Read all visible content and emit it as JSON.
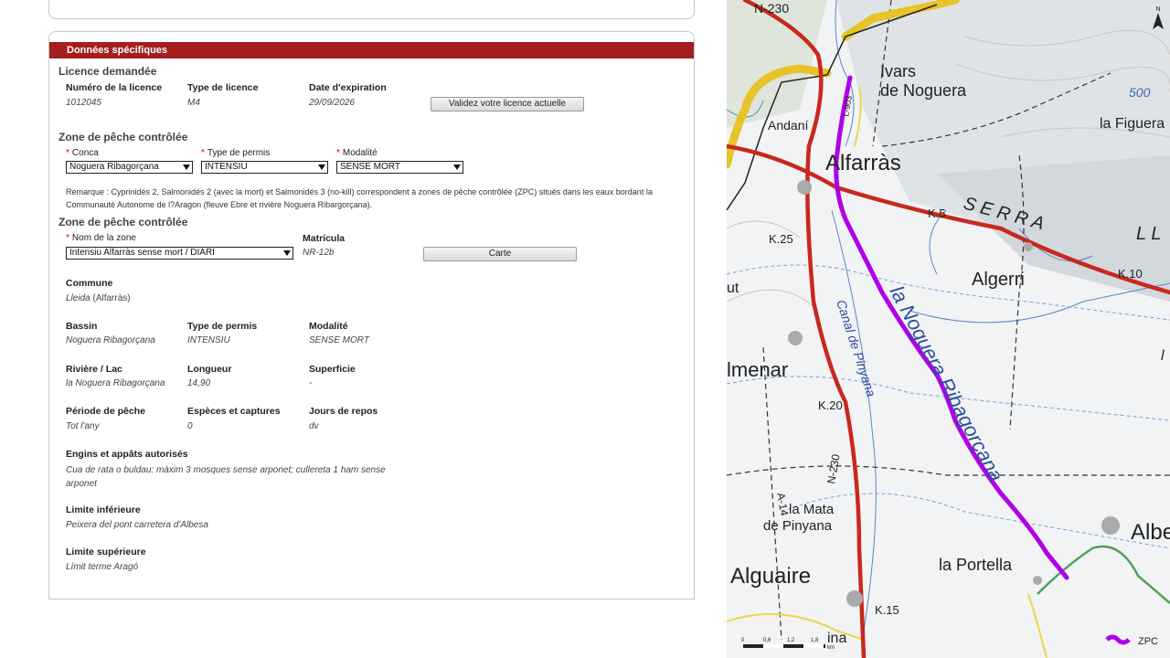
{
  "form": {
    "section_title": "Données spécifiques",
    "licence_heading": "Licence demandée",
    "licence": {
      "number_label": "Numéro de la licence",
      "number_value": "1012045",
      "type_label": "Type de licence",
      "type_value": "M4",
      "expiry_label": "Date d'expiration",
      "expiry_value": "29/09/2026",
      "validate_button": "Validez votre licence actuelle"
    },
    "zone_heading_1": "Zone de pêche contrôlée",
    "filters": {
      "conca_label": "Conca",
      "conca_value": "Noguera Ribagorçana",
      "permit_label": "Type de permis",
      "permit_value": "INTENSIU",
      "modality_label": "Modalité",
      "modality_value": "SENSE MORT"
    },
    "remark": "Remarque : Cyprinidés 2, Salmonidés 2 (avec la mort) et Salmonidés 3 (no-kill) correspondent à zones de pêche contrôlée (ZPC) situés dans les eaux bordant la Communauté Autonome de l?Aragon (fleuve Ebre et rivière Noguera Ribargorçana).",
    "zone_heading_2": "Zone de pêche contrôlée",
    "zone": {
      "name_label": "Nom de la zone",
      "name_value": "Intensiu Alfarràs sense mort / DIARI",
      "matricula_label": "Matrícula",
      "matricula_value": "NR-12b",
      "map_button": "Carte"
    },
    "commune": {
      "label": "Commune",
      "value_main": "Lleida",
      "value_extra": "(Alfarràs)"
    },
    "details": {
      "basin_label": "Bassin",
      "basin_value": "Noguera Ribagorçana",
      "permit_label": "Type de permis",
      "permit_value": "INTENSIU",
      "modality_label": "Modalité",
      "modality_value": "SENSE MORT",
      "river_label": "Rivière / Lac",
      "river_value": "la Noguera Ribagorçana",
      "length_label": "Longueur",
      "length_value": "14,90",
      "surface_label": "Superficie",
      "surface_value": "-",
      "period_label": "Période de pêche",
      "period_value": "Tot l'any",
      "species_label": "Espèces et captures",
      "species_value": "0",
      "rest_label": "Jours de repos",
      "rest_value": "dv",
      "gear_label": "Engins et appâts autorisés",
      "gear_value": "Cua de rata o buldau: màxim 3 mosques sense arponet; cullereta 1 ham sense arponet",
      "lower_label": "Limite inférieure",
      "lower_value": "Peixera del pont carretera d'Albesa",
      "upper_label": "Limite supérieure",
      "upper_value": "Límit terme Aragó"
    }
  },
  "map": {
    "places": {
      "ivars1": "Ivars",
      "ivars2": "de Noguera",
      "andani": "Andaní",
      "figuera": "la Figuera",
      "alfarras": "Alfarràs",
      "algerri": "Algerri",
      "almenar": "lmenar",
      "mata1": "la Mata",
      "mata2": "de Pinyana",
      "portella": "la Portella",
      "alguaire": "Alguaire",
      "albe": "Albe",
      "ut": "ut",
      "ina": "ina",
      "serra": "S E R R A",
      "ll": "L L",
      "l_edge": "l"
    },
    "roads": {
      "n230_top": "N-230",
      "l903": "L-903",
      "k5": "K.5",
      "k25": "K.25",
      "k10": "K.10",
      "k20": "K.20",
      "n230": "N-230",
      "a14": "A-14",
      "k15": "K.15",
      "contour": "500"
    },
    "labels": {
      "river": "la Noguera Ribagorçana",
      "canal": "Canal de Pinyana"
    },
    "scale": {
      "t0": "0",
      "t1": "0,6",
      "t2": "1,2",
      "t3": "1,8",
      "unit": "km"
    },
    "legend_label": "ZPC",
    "north_label": "N",
    "colors": {
      "zpc": "#b000e8",
      "road": "#c8281e",
      "header": "#a51e1e"
    }
  }
}
